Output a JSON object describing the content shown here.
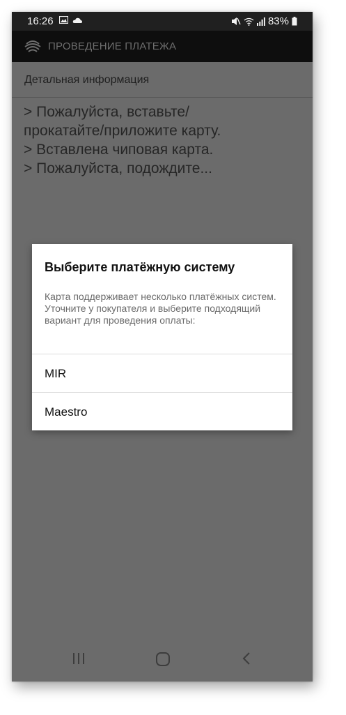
{
  "statusbar": {
    "time": "16:26",
    "battery": "83%",
    "icons": [
      "image-icon",
      "cloud-icon",
      "mute-icon",
      "wifi-icon",
      "signal-icon",
      "battery-icon"
    ]
  },
  "appbar": {
    "title": "ПРОВЕДЕНИЕ ПЛАТЕЖА",
    "logo_icon": "payment-logo-icon"
  },
  "details": {
    "header": "Детальная информация",
    "log": [
      "> Пожалуйста, вставьте/",
      "прокатайте/приложите карту.",
      "> Вставлена чиповая карта.",
      "> Пожалуйста, подождите..."
    ]
  },
  "dialog": {
    "title": "Выберите платёжную систему",
    "message": "Карта поддерживает несколько платёжных систем. Уточните у покупателя и выберите подходящий вариант для проведения оплаты:",
    "options": [
      "MIR",
      "Maestro"
    ]
  },
  "navbar": {
    "icons": [
      "recent-apps-icon",
      "home-icon",
      "back-icon"
    ]
  },
  "colors": {
    "statusbar_bg": "#202020",
    "appbar_bg": "#0e0e0e",
    "scrim_bg": "#6b6b6b",
    "dialog_bg": "#ffffff"
  }
}
